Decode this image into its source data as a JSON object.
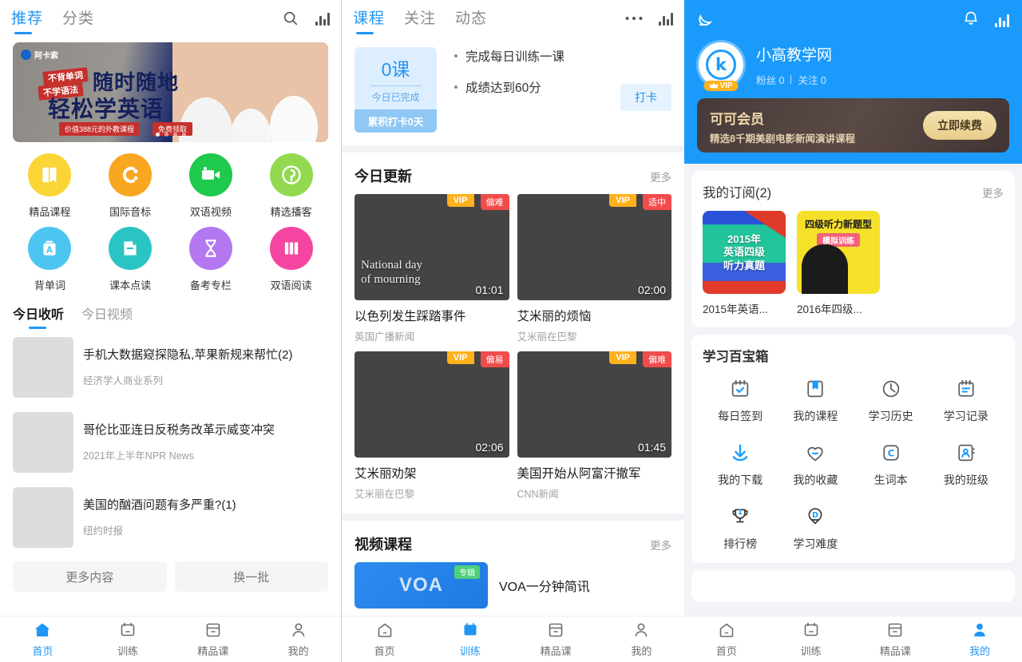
{
  "panel1": {
    "tabs": [
      {
        "label": "推荐",
        "active": true
      },
      {
        "label": "分类",
        "active": false
      }
    ],
    "icons": {
      "search": "search-icon",
      "stats": "bar-chart-icon"
    },
    "banner": {
      "brand": "阿卡索",
      "tag1": "不背单词",
      "tag2": "不学语法",
      "headline1": "随时随地",
      "headline2": "轻松学英语",
      "price_tag": "价值388元的外教课程",
      "free_tag": "免费领取",
      "dots": 4,
      "active_dot": 0
    },
    "quick_icons": [
      {
        "label": "精品课程",
        "icon": "book-icon",
        "color": "#fbd436"
      },
      {
        "label": "国际音标",
        "icon": "phonetic-icon",
        "color": "#f9a620"
      },
      {
        "label": "双语视频",
        "icon": "video-camera-icon",
        "color": "#1ec94c"
      },
      {
        "label": "精选播客",
        "icon": "podcast-icon",
        "color": "#92d94f"
      },
      {
        "label": "背单词",
        "icon": "vocabulary-card-icon",
        "color": "#4cc6f0"
      },
      {
        "label": "课本点读",
        "icon": "textbook-icon",
        "color": "#2bc4c4"
      },
      {
        "label": "备考专栏",
        "icon": "hourglass-icon",
        "color": "#b377f0"
      },
      {
        "label": "双语阅读",
        "icon": "books-icon",
        "color": "#f545a0"
      }
    ],
    "sub_tabs": [
      {
        "label": "今日收听",
        "active": true
      },
      {
        "label": "今日视频",
        "active": false
      }
    ],
    "listen_list": [
      {
        "title": "手机大数据窥探隐私,苹果新规来帮忙(2)",
        "source": "经济学人商业系列",
        "thumb": "news-thumb-privacy"
      },
      {
        "title": "哥伦比亚连日反税务改革示威变冲突",
        "source": "2021年上半年NPR News",
        "thumb": "news-thumb-protest"
      },
      {
        "title": "美国的酗酒问题有多严重?(1)",
        "source": "纽约时报",
        "thumb": "news-thumb-drinks"
      }
    ],
    "buttons": [
      {
        "label": "更多内容"
      },
      {
        "label": "换一批"
      }
    ],
    "bottom_nav": [
      {
        "label": "首页",
        "icon": "home-icon",
        "active": true
      },
      {
        "label": "训练",
        "icon": "training-icon",
        "active": false
      },
      {
        "label": "精品课",
        "icon": "course-icon",
        "active": false
      },
      {
        "label": "我的",
        "icon": "user-icon",
        "active": false
      }
    ]
  },
  "panel2": {
    "tabs": [
      {
        "label": "课程",
        "active": true
      },
      {
        "label": "关注",
        "active": false
      },
      {
        "label": "动态",
        "active": false
      }
    ],
    "icons": {
      "more": "more-dots-icon",
      "stats": "bar-chart-icon"
    },
    "checkin": {
      "count": "0课",
      "caption": "今日已完成",
      "streak": "累积打卡0天",
      "goals": [
        "完成每日训练一课",
        "成绩达到60分"
      ],
      "button": "打卡"
    },
    "today_update": {
      "title": "今日更新",
      "more": "更多",
      "videos": [
        {
          "title": "以色列发生踩踏事件",
          "source": "英国广播新闻",
          "duration": "01:01",
          "vip": "VIP",
          "level": "偏难",
          "overlay": "National day\nof mourning",
          "img": "video-thumb-israel"
        },
        {
          "title": "艾米丽的烦恼",
          "source": "艾米丽在巴黎",
          "duration": "02:00",
          "vip": "VIP",
          "level": "适中",
          "overlay": "",
          "img": "video-thumb-emily1"
        },
        {
          "title": "艾米丽劝架",
          "source": "艾米丽在巴黎",
          "duration": "02:06",
          "vip": "VIP",
          "level": "偏易",
          "overlay": "",
          "img": "video-thumb-emily2"
        },
        {
          "title": "美国开始从阿富汗撤军",
          "source": "CNN新闻",
          "duration": "01:45",
          "vip": "VIP",
          "level": "偏难",
          "overlay": "",
          "img": "video-thumb-afghan"
        }
      ]
    },
    "video_courses": {
      "title": "视频课程",
      "more": "更多",
      "items": [
        {
          "title": "VOA一分钟简讯",
          "badge": "专辑",
          "logo": "VOA"
        }
      ]
    },
    "bottom_nav": [
      {
        "label": "首页",
        "icon": "home-icon",
        "active": false
      },
      {
        "label": "训练",
        "icon": "training-icon",
        "active": true
      },
      {
        "label": "精品课",
        "icon": "course-icon",
        "active": false
      },
      {
        "label": "我的",
        "icon": "user-icon",
        "active": false
      }
    ]
  },
  "panel3": {
    "header": {
      "left_icon": "moon-icon",
      "bell_icon": "bell-icon",
      "stats_icon": "bar-chart-icon",
      "username": "小高教学网",
      "avatar_letter": "k",
      "vip_badge": "VIP",
      "followers_label": "粉丝 0",
      "following_label": "关注 0",
      "bg_color": "#1a9bfc"
    },
    "vip_card": {
      "title": "可可会员",
      "subtitle": "精选8千期美剧电影新闻演讲课程",
      "button": "立即续费"
    },
    "subscriptions": {
      "title": "我的订阅(2)",
      "more": "更多",
      "items": [
        {
          "name": "2015年英语...",
          "cover_text": "2015年\n英语四级\n听力真题"
        },
        {
          "name": "2016年四级...",
          "cover_text": "四级听力新题型"
        }
      ]
    },
    "toolbox": {
      "title": "学习百宝箱",
      "items": [
        {
          "label": "每日签到",
          "icon": "calendar-check-icon"
        },
        {
          "label": "我的课程",
          "icon": "bookmark-icon"
        },
        {
          "label": "学习历史",
          "icon": "clock-icon"
        },
        {
          "label": "学习记录",
          "icon": "notes-icon"
        },
        {
          "label": "我的下载",
          "icon": "download-icon"
        },
        {
          "label": "我的收藏",
          "icon": "heart-icon"
        },
        {
          "label": "生词本",
          "icon": "c-square-icon"
        },
        {
          "label": "我的班级",
          "icon": "contact-icon"
        },
        {
          "label": "排行榜",
          "icon": "trophy-icon"
        },
        {
          "label": "学习难度",
          "icon": "difficulty-icon"
        }
      ]
    },
    "bottom_nav": [
      {
        "label": "首页",
        "icon": "home-icon",
        "active": false
      },
      {
        "label": "训练",
        "icon": "training-icon",
        "active": false
      },
      {
        "label": "精品课",
        "icon": "course-icon",
        "active": false
      },
      {
        "label": "我的",
        "icon": "user-icon",
        "active": true
      }
    ]
  }
}
